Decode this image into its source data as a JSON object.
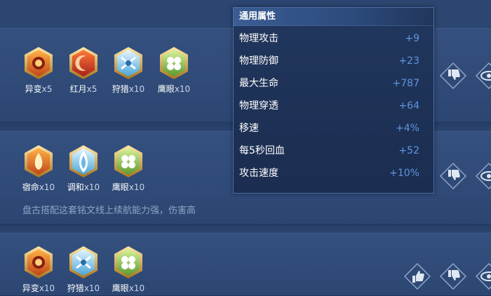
{
  "builds": [
    {
      "runes": [
        {
          "name": "异变",
          "count": "x5",
          "icon": "yibian-gem-icon"
        },
        {
          "name": "红月",
          "count": "x5",
          "icon": "hongyue-gem-icon"
        },
        {
          "name": "狩猎",
          "count": "x10",
          "icon": "shoulie-gem-icon"
        },
        {
          "name": "鹰眼",
          "count": "x10",
          "icon": "yingyan-gem-icon"
        }
      ]
    },
    {
      "runes": [
        {
          "name": "宿命",
          "count": "x10",
          "icon": "suming-gem-icon"
        },
        {
          "name": "调和",
          "count": "x10",
          "icon": "tiaohe-gem-icon"
        },
        {
          "name": "鹰眼",
          "count": "x10",
          "icon": "yingyan-gem-icon"
        }
      ],
      "description": "盘古搭配这套铭文线上续航能力强，伤害高"
    },
    {
      "runes": [
        {
          "name": "异变",
          "count": "x10",
          "icon": "yibian-gem-icon"
        },
        {
          "name": "狩猎",
          "count": "x10",
          "icon": "shoulie-gem-icon"
        },
        {
          "name": "鹰眼",
          "count": "x10",
          "icon": "yingyan-gem-icon"
        }
      ]
    }
  ],
  "tooltip": {
    "title": "通用属性",
    "stats": [
      {
        "label": "物理攻击",
        "value": "+9"
      },
      {
        "label": "物理防御",
        "value": "+23"
      },
      {
        "label": "最大生命",
        "value": "+787"
      },
      {
        "label": "物理穿透",
        "value": "+64"
      },
      {
        "label": "移速",
        "value": "+4%"
      },
      {
        "label": "每5秒回血",
        "value": "+52"
      },
      {
        "label": "攻击速度",
        "value": "+10%"
      }
    ]
  },
  "icons": {
    "like": "thumbs-up-icon",
    "dislike": "thumbs-down-icon",
    "view": "eye-icon"
  },
  "colors": {
    "background": "#2a4673",
    "tooltip_bg": "#1e3257",
    "stat_value": "#5f95e0",
    "description": "#8ea3c4"
  }
}
